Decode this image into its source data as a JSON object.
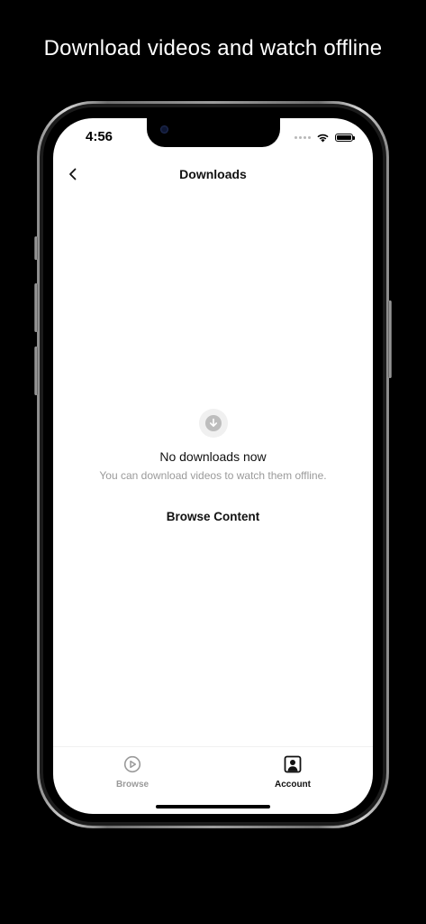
{
  "headline": "Download videos and watch offline",
  "status_bar": {
    "time": "4:56"
  },
  "nav": {
    "title": "Downloads",
    "back_icon": "chevron-left-icon"
  },
  "empty_state": {
    "icon": "download-arrow-icon",
    "title": "No downloads now",
    "subtitle": "You can download videos to watch them offline.",
    "action_label": "Browse Content"
  },
  "tabbar": {
    "tabs": [
      {
        "label": "Browse",
        "icon": "play-circle-icon",
        "active": false,
        "color": "#9a9a9a"
      },
      {
        "label": "Account",
        "icon": "account-icon",
        "active": true,
        "color": "#111111"
      }
    ]
  },
  "colors": {
    "background": "#000000",
    "screen": "#ffffff",
    "inactive": "#9a9a9a",
    "active": "#111111"
  }
}
